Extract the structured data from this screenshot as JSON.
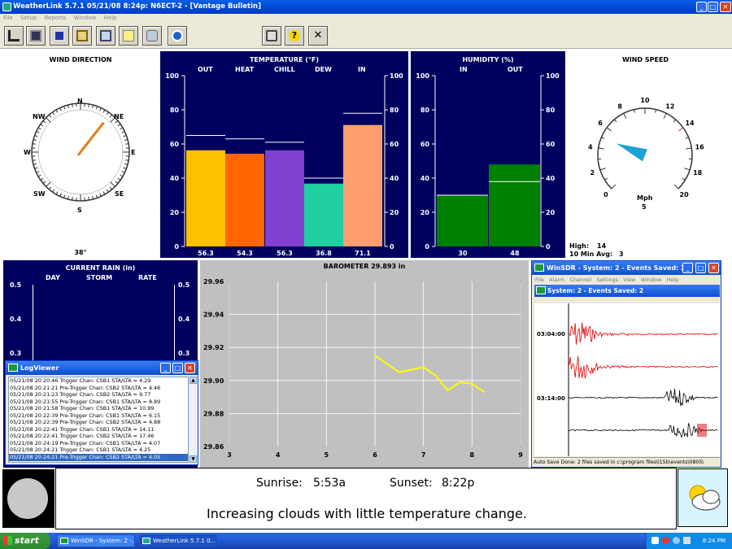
{
  "window": {
    "title": "WeatherLink 5.7.1  05/21/08  8:24p: N6ECT-2 - [Vantage Bulletin]"
  },
  "menu": [
    "File",
    "Setup",
    "Reports",
    "Window",
    "Help"
  ],
  "wind_direction": {
    "title": "WIND DIRECTION",
    "compass": [
      "N",
      "NE",
      "E",
      "SE",
      "S",
      "SW",
      "W",
      "NW"
    ],
    "degrees": 38,
    "reading": "38°"
  },
  "temperature": {
    "title": "TEMPERATURE  (°F)",
    "scale": [
      100,
      80,
      60,
      40,
      20,
      0
    ],
    "columns": [
      "OUT",
      "HEAT",
      "CHILL",
      "DEW",
      "IN"
    ],
    "values": [
      "56.3",
      "54.3",
      "56.3",
      "36.8",
      "71.1"
    ],
    "highs": [
      65,
      63,
      61,
      40,
      78
    ],
    "colors": [
      "#ffc000",
      "#ff6600",
      "#8040d0",
      "#20d0a0",
      "#ff9f70"
    ]
  },
  "humidity": {
    "title": "HUMIDITY  (%)",
    "scale": [
      100,
      80,
      60,
      40,
      20,
      0
    ],
    "columns": [
      "IN",
      "OUT"
    ],
    "values": [
      "30",
      "48"
    ],
    "highs": [
      30,
      38
    ],
    "color": "#008000"
  },
  "wind_speed": {
    "title": "WIND SPEED",
    "scale": [
      "0",
      "2",
      "4",
      "6",
      "8",
      "10",
      "12",
      "14",
      "16",
      "18",
      "20"
    ],
    "value": 5,
    "unit": "Mph",
    "reading": "5",
    "high_label": "High:",
    "high_value": "14",
    "avg_label": "10 Min Avg:",
    "avg_value": "3"
  },
  "rain": {
    "title": "CURRENT RAIN  (in)",
    "columns": [
      "DAY",
      "STORM",
      "RATE"
    ],
    "scale": [
      "0.5",
      "0.4",
      "0.3"
    ]
  },
  "barometer": {
    "title": "BAROMETER 29.893 in"
  },
  "chart_data": {
    "type": "line",
    "title": "BAROMETER 29.893 in",
    "x": [
      6,
      6.5,
      7,
      7.25,
      7.5,
      7.75,
      8,
      8.25
    ],
    "y": [
      29.915,
      29.905,
      29.908,
      29.903,
      29.894,
      29.899,
      29.898,
      29.893
    ],
    "xlim": [
      3,
      9
    ],
    "ylim": [
      29.86,
      29.96
    ],
    "xticks": [
      "3",
      "4",
      "5",
      "6",
      "7",
      "8",
      "9"
    ],
    "yticks": [
      "29.96",
      "29.94",
      "29.92",
      "29.90",
      "29.88",
      "29.86"
    ],
    "color": "#ffff00",
    "grid": true
  },
  "logviewer": {
    "title": "LogViewer",
    "lines": [
      "05/21/08 20:20:46 Trigger Chan: CSB1 STA/LTA = 4.29",
      "05/21/08 20:21:21 Pre-Trigger Chan: CSB2 STA/LTA = 4.46",
      "05/21/08 20:21:23 Trigger Chan: CSB2 STA/LTA = 9.77",
      "05/21/08 20:21:55 Pre-Trigger Chan: CSB1 STA/LTA = 8.89",
      "05/21/08 20:21:58 Trigger Chan: CSB1 STA/LTA = 10.99",
      "05/21/08 20:22:39 Pre-Trigger Chan: CSB1 STA/LTA = 6.15",
      "05/21/08 20:22:39 Pre-Trigger Chan: CSB2 STA/LTA = 4.88",
      "05/21/08 20:22:41 Trigger Chan: CSB1 STA/LTA = 14.11",
      "05/21/08 20:22:41 Trigger Chan: CSB2 STA/LTA = 17.46",
      "05/21/08 20:24:19 Pre-Trigger Chan: CSB1 STA/LTA = 4.07",
      "05/21/08 20:24:21 Trigger Chan: CSB1 STA/LTA = 4.25",
      "05/21/08 20:24:21 Pre-Trigger Chan: CSB2 STA/LTA = 4.05"
    ]
  },
  "winsdr": {
    "title": "WinSDR - System: 2 - Events Saved: 2",
    "menu": [
      "File",
      "Alarm",
      "Channel",
      "Settings",
      "View",
      "Window",
      "Help"
    ],
    "inner_title": "System: 2 - Events Saved: 2",
    "times": [
      "03:04:00",
      "03:14:00"
    ],
    "status": "Auto Save Done: 2 files saved in c:\\program files\\l15b\\events\\0805\\"
  },
  "forecast": {
    "sunrise_label": "Sunrise:",
    "sunrise": "5:53a",
    "sunset_label": "Sunset:",
    "sunset": "8:22p",
    "text": "Increasing clouds with little temperature change."
  },
  "taskbar": {
    "start": "start",
    "items": [
      "WinSDR - System: 2 -...",
      "WeatherLink 5.7.1  0..."
    ],
    "clock": "8:24 PM"
  }
}
